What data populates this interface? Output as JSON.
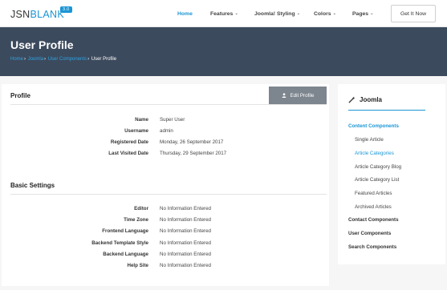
{
  "header": {
    "logo_main": "JSN",
    "logo_accent": "BLANK",
    "logo_version": "3.0",
    "nav": [
      {
        "label": "Home",
        "active": true,
        "dropdown": false
      },
      {
        "label": "Features",
        "active": false,
        "dropdown": true
      },
      {
        "label": "Joomla! Styling",
        "active": false,
        "dropdown": true
      },
      {
        "label": "Colors",
        "active": false,
        "dropdown": true
      },
      {
        "label": "Pages",
        "active": false,
        "dropdown": true
      }
    ],
    "cta": "Get It Now"
  },
  "banner": {
    "title": "User Profile",
    "breadcrumbs": [
      "Home",
      "Joomla",
      "User Components",
      "User Profile"
    ]
  },
  "profile": {
    "title": "Profile",
    "edit_button": "Edit Profile",
    "fields": [
      {
        "label": "Name",
        "value": "Super User"
      },
      {
        "label": "Username",
        "value": "admin"
      },
      {
        "label": "Registered Date",
        "value": "Monday, 26 September 2017"
      },
      {
        "label": "Last Visited Date",
        "value": "Thursday, 29 September 2017"
      }
    ]
  },
  "basic_settings": {
    "title": "Basic Settings",
    "fields": [
      {
        "label": "Editor",
        "value": "No Information Entered"
      },
      {
        "label": "Time Zone",
        "value": "No Information Entered"
      },
      {
        "label": "Frontend Language",
        "value": "No Information Entered"
      },
      {
        "label": "Backend Template Style",
        "value": "No Information Entered"
      },
      {
        "label": "Backend Language",
        "value": "No Information Entered"
      },
      {
        "label": "Help Site",
        "value": "No Information Entered"
      }
    ]
  },
  "sidebar": {
    "title": "Joomla",
    "icon": "magic-wand-icon",
    "items": [
      {
        "label": "Content Components",
        "level": 0,
        "active": true
      },
      {
        "label": "Single Article",
        "level": 1,
        "active": false
      },
      {
        "label": "Article Categories",
        "level": 1,
        "active": true
      },
      {
        "label": "Article Category Blog",
        "level": 1,
        "active": false
      },
      {
        "label": "Article Category List",
        "level": 1,
        "active": false
      },
      {
        "label": "Featured Articles",
        "level": 1,
        "active": false
      },
      {
        "label": "Archived Articles",
        "level": 1,
        "active": false
      },
      {
        "label": "Contact Components",
        "level": 0,
        "active": false
      },
      {
        "label": "User Components",
        "level": 0,
        "active": false
      },
      {
        "label": "Search Components",
        "level": 0,
        "active": false
      }
    ]
  },
  "colors": {
    "accent": "#1a95d5",
    "banner": "#3c4a5d",
    "edit_button": "#7d858e"
  }
}
